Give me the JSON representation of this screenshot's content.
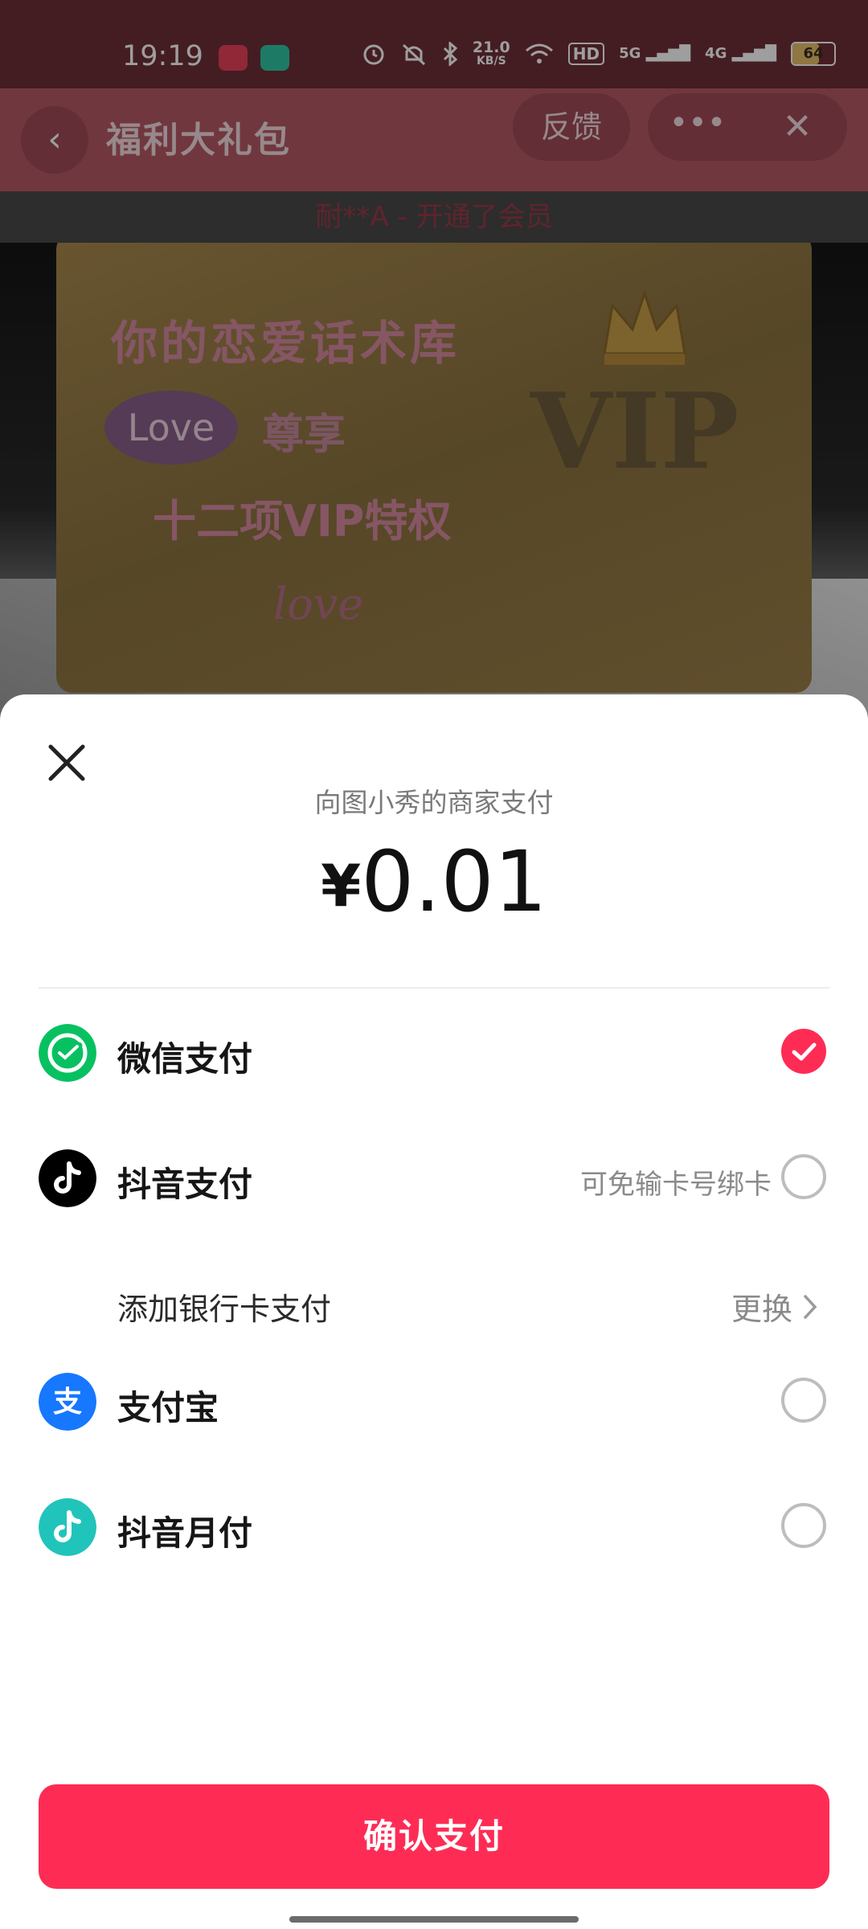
{
  "status_bar": {
    "time": "19:19",
    "network_speed_value": "21.0",
    "network_speed_unit": "KB/S",
    "hd_label": "HD",
    "signal_1": "5G",
    "signal_2": "4G",
    "battery": "64"
  },
  "top_bar": {
    "title": "福利大礼包",
    "feedback_label": "反馈",
    "more_glyph": "•••",
    "close_glyph": "✕",
    "back_glyph": "‹"
  },
  "marquee": {
    "text": "耐**A - 开通了会员"
  },
  "vip_card": {
    "title": "你的恋爱话术库",
    "love_pill": "Love",
    "enjoy": "尊享",
    "privileges": "十二项VIP特权",
    "love_sign": "love",
    "badge_text": "VIP"
  },
  "payment": {
    "payee": "向图小秀的商家支付",
    "currency": "¥",
    "amount": "0.01",
    "methods": [
      {
        "label": "微信支付",
        "selected": true,
        "color": "#07c160"
      },
      {
        "label": "抖音支付",
        "hint": "可免输卡号绑卡",
        "selected": false,
        "color": "#000000"
      },
      {
        "label": "支付宝",
        "selected": false,
        "color": "#1677ff"
      },
      {
        "label": "抖音月付",
        "selected": false,
        "color": "#20c4ba"
      }
    ],
    "add_card": {
      "label": "添加银行卡支付",
      "action": "更换"
    },
    "confirm_label": "确认支付"
  },
  "colors": {
    "accent": "#fe2c55",
    "wechat": "#07c160",
    "alipay": "#1677ff"
  }
}
